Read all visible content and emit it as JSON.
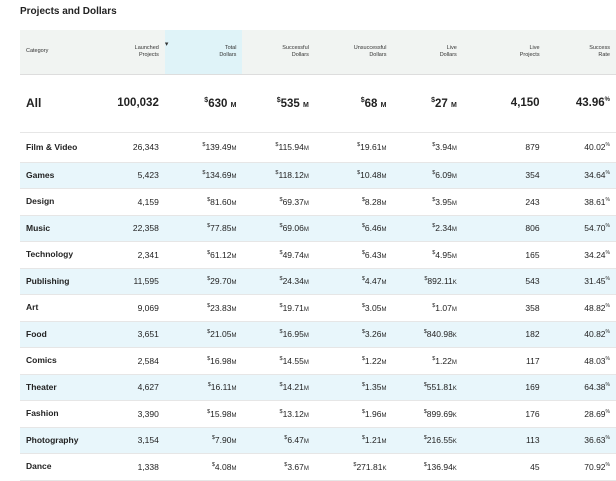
{
  "title": "Projects and Dollars",
  "headers": {
    "category": "Category",
    "launched": [
      "Launched",
      "Projects"
    ],
    "sort_indicator": "▾",
    "total": [
      "Total",
      "Dollars"
    ],
    "successful": [
      "Successful",
      "Dollars"
    ],
    "unsuccessful": [
      "Unsuccessful",
      "Dollars"
    ],
    "live_dollars": [
      "Live",
      "Dollars"
    ],
    "live_projects": [
      "Live",
      "Projects"
    ],
    "success_rate": [
      "Success",
      "Rate"
    ]
  },
  "currency_symbol": "$",
  "percent_symbol": "%",
  "all": {
    "category": "All",
    "launched": "100,032",
    "total": {
      "amount": "630",
      "unit": "M"
    },
    "successful": {
      "amount": "535",
      "unit": "M"
    },
    "unsuccessful": {
      "amount": "68",
      "unit": "M"
    },
    "live_dollars": {
      "amount": "27",
      "unit": "M"
    },
    "live_projects": "4,150",
    "success_rate": "43.96"
  },
  "rows": [
    {
      "category": "Film & Video",
      "launched": "26,343",
      "total": {
        "amount": "139.49",
        "unit": "M"
      },
      "successful": {
        "amount": "115.94",
        "unit": "M"
      },
      "unsuccessful": {
        "amount": "19.61",
        "unit": "M"
      },
      "live_dollars": {
        "amount": "3.94",
        "unit": "M"
      },
      "live_projects": "879",
      "success_rate": "40.02"
    },
    {
      "category": "Games",
      "launched": "5,423",
      "total": {
        "amount": "134.69",
        "unit": "M"
      },
      "successful": {
        "amount": "118.12",
        "unit": "M"
      },
      "unsuccessful": {
        "amount": "10.48",
        "unit": "M"
      },
      "live_dollars": {
        "amount": "6.09",
        "unit": "M"
      },
      "live_projects": "354",
      "success_rate": "34.64"
    },
    {
      "category": "Design",
      "launched": "4,159",
      "total": {
        "amount": "81.60",
        "unit": "M"
      },
      "successful": {
        "amount": "69.37",
        "unit": "M"
      },
      "unsuccessful": {
        "amount": "8.28",
        "unit": "M"
      },
      "live_dollars": {
        "amount": "3.95",
        "unit": "M"
      },
      "live_projects": "243",
      "success_rate": "38.61"
    },
    {
      "category": "Music",
      "launched": "22,358",
      "total": {
        "amount": "77.85",
        "unit": "M"
      },
      "successful": {
        "amount": "69.06",
        "unit": "M"
      },
      "unsuccessful": {
        "amount": "6.46",
        "unit": "M"
      },
      "live_dollars": {
        "amount": "2.34",
        "unit": "M"
      },
      "live_projects": "806",
      "success_rate": "54.70"
    },
    {
      "category": "Technology",
      "launched": "2,341",
      "total": {
        "amount": "61.12",
        "unit": "M"
      },
      "successful": {
        "amount": "49.74",
        "unit": "M"
      },
      "unsuccessful": {
        "amount": "6.43",
        "unit": "M"
      },
      "live_dollars": {
        "amount": "4.95",
        "unit": "M"
      },
      "live_projects": "165",
      "success_rate": "34.24"
    },
    {
      "category": "Publishing",
      "launched": "11,595",
      "total": {
        "amount": "29.70",
        "unit": "M"
      },
      "successful": {
        "amount": "24.34",
        "unit": "M"
      },
      "unsuccessful": {
        "amount": "4.47",
        "unit": "M"
      },
      "live_dollars": {
        "amount": "892.11",
        "unit": "K"
      },
      "live_projects": "543",
      "success_rate": "31.45"
    },
    {
      "category": "Art",
      "launched": "9,069",
      "total": {
        "amount": "23.83",
        "unit": "M"
      },
      "successful": {
        "amount": "19.71",
        "unit": "M"
      },
      "unsuccessful": {
        "amount": "3.05",
        "unit": "M"
      },
      "live_dollars": {
        "amount": "1.07",
        "unit": "M"
      },
      "live_projects": "358",
      "success_rate": "48.82"
    },
    {
      "category": "Food",
      "launched": "3,651",
      "total": {
        "amount": "21.05",
        "unit": "M"
      },
      "successful": {
        "amount": "16.95",
        "unit": "M"
      },
      "unsuccessful": {
        "amount": "3.26",
        "unit": "M"
      },
      "live_dollars": {
        "amount": "840.98",
        "unit": "K"
      },
      "live_projects": "182",
      "success_rate": "40.82"
    },
    {
      "category": "Comics",
      "launched": "2,584",
      "total": {
        "amount": "16.98",
        "unit": "M"
      },
      "successful": {
        "amount": "14.55",
        "unit": "M"
      },
      "unsuccessful": {
        "amount": "1.22",
        "unit": "M"
      },
      "live_dollars": {
        "amount": "1.22",
        "unit": "M"
      },
      "live_projects": "117",
      "success_rate": "48.03"
    },
    {
      "category": "Theater",
      "launched": "4,627",
      "total": {
        "amount": "16.11",
        "unit": "M"
      },
      "successful": {
        "amount": "14.21",
        "unit": "M"
      },
      "unsuccessful": {
        "amount": "1.35",
        "unit": "M"
      },
      "live_dollars": {
        "amount": "551.81",
        "unit": "K"
      },
      "live_projects": "169",
      "success_rate": "64.38"
    },
    {
      "category": "Fashion",
      "launched": "3,390",
      "total": {
        "amount": "15.98",
        "unit": "M"
      },
      "successful": {
        "amount": "13.12",
        "unit": "M"
      },
      "unsuccessful": {
        "amount": "1.96",
        "unit": "M"
      },
      "live_dollars": {
        "amount": "899.69",
        "unit": "K"
      },
      "live_projects": "176",
      "success_rate": "28.69"
    },
    {
      "category": "Photography",
      "launched": "3,154",
      "total": {
        "amount": "7.90",
        "unit": "M"
      },
      "successful": {
        "amount": "6.47",
        "unit": "M"
      },
      "unsuccessful": {
        "amount": "1.21",
        "unit": "M"
      },
      "live_dollars": {
        "amount": "216.55",
        "unit": "K"
      },
      "live_projects": "113",
      "success_rate": "36.63"
    },
    {
      "category": "Dance",
      "launched": "1,338",
      "total": {
        "amount": "4.08",
        "unit": "M"
      },
      "successful": {
        "amount": "3.67",
        "unit": "M"
      },
      "unsuccessful": {
        "amount": "271.81",
        "unit": "K"
      },
      "live_dollars": {
        "amount": "136.94",
        "unit": "K"
      },
      "live_projects": "45",
      "success_rate": "70.92"
    }
  ]
}
